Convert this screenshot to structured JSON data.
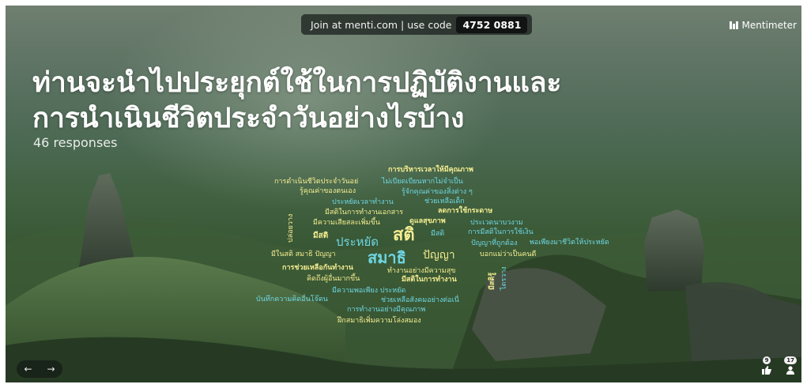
{
  "header": {
    "join_text": "Join at menti.com | use code",
    "code": "4752 0881",
    "brand": "Mentimeter"
  },
  "question": {
    "line1": "ท่านจะนำไปประยุกต์ใช้ในการปฏิบัติงานและ",
    "line2": "การนำเนินชีวิตประจำวันอย่างไรบ้าง",
    "responses": "46 responses"
  },
  "wordcloud": [
    {
      "id": "w1",
      "text": "การบริหารเวลาให้มีคุณภาพ",
      "color": "#f4ed90",
      "size": 9,
      "weight": "bold"
    },
    {
      "id": "w2",
      "text": "การดำเนินชีวิตประจำวันอย่",
      "color": "#f4ed90",
      "size": 9,
      "weight": "normal"
    },
    {
      "id": "w3",
      "text": "ไม่เบียดเบียนหากไม่จำเป็น",
      "color": "#6ed7e4",
      "size": 9,
      "weight": "normal"
    },
    {
      "id": "w4",
      "text": "รู้คุณค่าของตนเอง",
      "color": "#f4ed90",
      "size": 9,
      "weight": "normal"
    },
    {
      "id": "w5",
      "text": "รู้จักคุณค่าของสิ่งต่าง ๆ",
      "color": "#6ed7e4",
      "size": 9,
      "weight": "normal"
    },
    {
      "id": "w6",
      "text": "ประหยัดเวลาทำงาน",
      "color": "#6ed7e4",
      "size": 9,
      "weight": "normal"
    },
    {
      "id": "w7",
      "text": "ช่วยเหลือเด็ก",
      "color": "#6ed7e4",
      "size": 9,
      "weight": "normal"
    },
    {
      "id": "w8",
      "text": "มีสติในการทำงานเอกสาร",
      "color": "#f4ed90",
      "size": 9,
      "weight": "normal"
    },
    {
      "id": "w9",
      "text": "ลดการใช้กระดาษ",
      "color": "#f4ed90",
      "size": 9,
      "weight": "bold"
    },
    {
      "id": "w10",
      "text": "มีความเสียสละเพิ่มขึ้น",
      "color": "#f4ed90",
      "size": 9,
      "weight": "normal"
    },
    {
      "id": "w11",
      "text": "ดูแลสุขภาพ",
      "color": "#f4ed90",
      "size": 9,
      "weight": "bold"
    },
    {
      "id": "w12",
      "text": "ประเวดนาบวงาม",
      "color": "#6ed7e4",
      "size": 9,
      "weight": "normal"
    },
    {
      "id": "w13",
      "text": "การมีสติในการใช้เงิน",
      "color": "#6ed7e4",
      "size": 9,
      "weight": "normal"
    },
    {
      "id": "w14",
      "text": "มีสติ",
      "color": "#f4ed90",
      "size": 10,
      "weight": "bold"
    },
    {
      "id": "w15",
      "text": "ประหยัด",
      "color": "#6ed7e4",
      "size": 15,
      "weight": "normal"
    },
    {
      "id": "w16",
      "text": "สติ",
      "color": "#f4ed90",
      "size": 22,
      "weight": "bold"
    },
    {
      "id": "w17",
      "text": "มีสติ",
      "color": "#6ed7e4",
      "size": 9,
      "weight": "normal"
    },
    {
      "id": "w18",
      "text": "พอเพียงมาชีวิตให้ประหยัด",
      "color": "#6ed7e4",
      "size": 9,
      "weight": "normal"
    },
    {
      "id": "w19",
      "text": "ปัญญาที่ถูกต้อง",
      "color": "#6ed7e4",
      "size": 9,
      "weight": "normal"
    },
    {
      "id": "w20",
      "text": "มีในสติ สมาธิ ปัญญา",
      "color": "#f4ed90",
      "size": 9,
      "weight": "normal"
    },
    {
      "id": "w21",
      "text": "สมาธิ",
      "color": "#6ed7e4",
      "size": 20,
      "weight": "bold"
    },
    {
      "id": "w22",
      "text": "ปัญญา",
      "color": "#f4ed90",
      "size": 14,
      "weight": "normal"
    },
    {
      "id": "w23",
      "text": "บอกแม่ว่าเป็นคนดี",
      "color": "#f4ed90",
      "size": 9,
      "weight": "normal"
    },
    {
      "id": "w24",
      "text": "การช่วยเหลือกันทำงาน",
      "color": "#f4ed90",
      "size": 9,
      "weight": "bold"
    },
    {
      "id": "w25",
      "text": "ทำงานอย่างมีความสุข",
      "color": "#f4ed90",
      "size": 9,
      "weight": "normal"
    },
    {
      "id": "w26",
      "text": "คิดถึงผู้อื่นมากขึ้น",
      "color": "#f4ed90",
      "size": 9,
      "weight": "normal"
    },
    {
      "id": "w27",
      "text": "มีสติในการทำงาน",
      "color": "#f4ed90",
      "size": 9,
      "weight": "bold"
    },
    {
      "id": "w28",
      "text": "มีความพอเพียง ประหยัด",
      "color": "#6ed7e4",
      "size": 9,
      "weight": "normal"
    },
    {
      "id": "w29",
      "text": "บันทึกความคิดอื่นโจ๊ตน",
      "color": "#6ed7e4",
      "size": 9,
      "weight": "normal"
    },
    {
      "id": "w30",
      "text": "ช่วยเหลือสังคมอย่างต่อเนื่",
      "color": "#6ed7e4",
      "size": 9,
      "weight": "normal"
    },
    {
      "id": "w31",
      "text": "การทำงานอย่างมีคุณภาพ",
      "color": "#6ed7e4",
      "size": 9,
      "weight": "normal"
    },
    {
      "id": "w32",
      "text": "ฝึกสมาธิเพิ่มความโล่งสมอง",
      "color": "#f4ed90",
      "size": 9,
      "weight": "normal"
    },
    {
      "id": "w33",
      "text": "ปล่อยวาง",
      "color": "#f4ed90",
      "size": 9,
      "weight": "normal"
    },
    {
      "id": "w34",
      "text": "มีสติรู้",
      "color": "#f4ed90",
      "size": 9,
      "weight": "bold"
    },
    {
      "id": "w35",
      "text": "ไตรวาง",
      "color": "#6ed7e4",
      "size": 9,
      "weight": "normal"
    }
  ],
  "controls": {
    "prev": "←",
    "next": "→",
    "reactions_count": "9",
    "participants_count": "17"
  },
  "colors": {
    "accent_yellow": "#f4ed90",
    "accent_cyan": "#6ed7e4",
    "title": "#ffffff"
  }
}
